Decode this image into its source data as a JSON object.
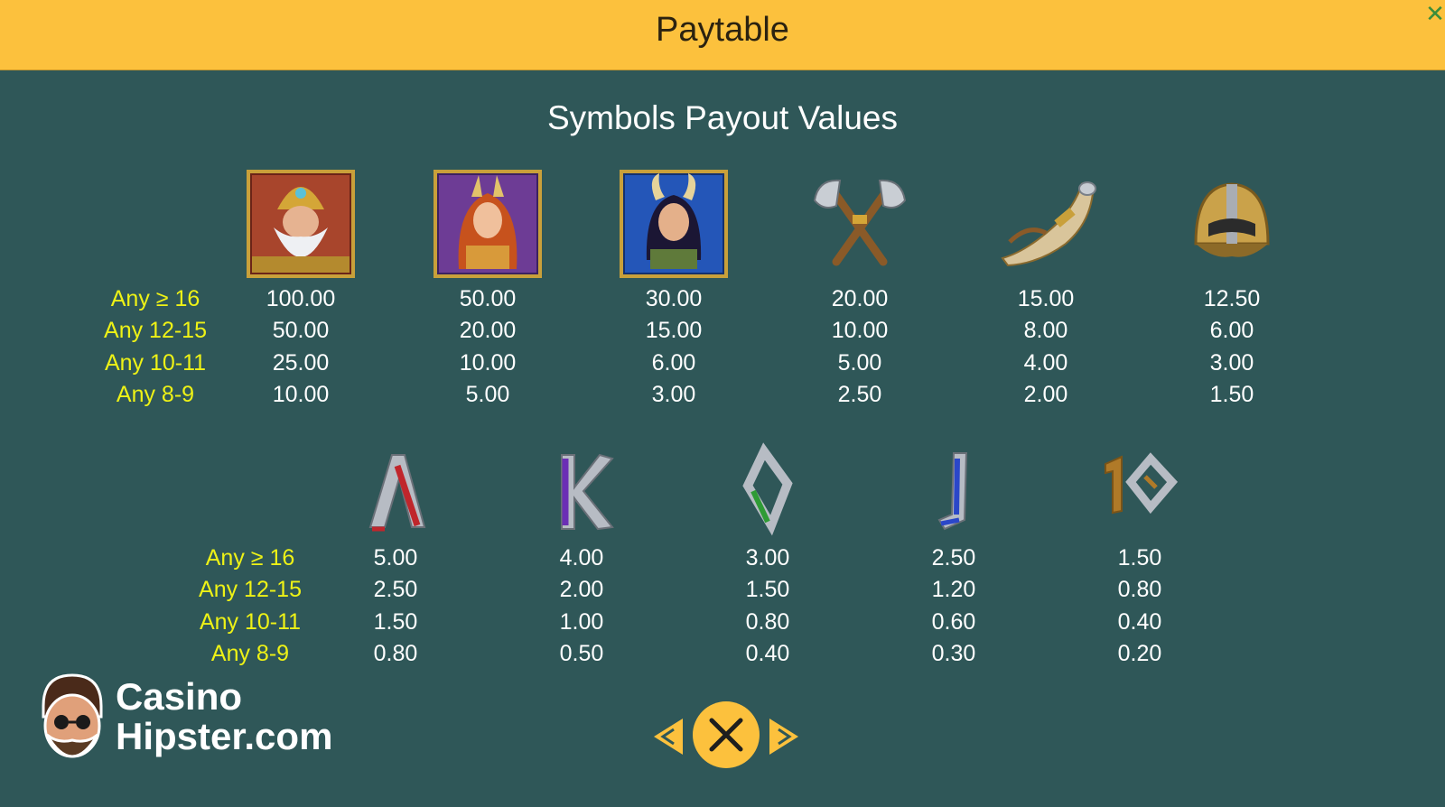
{
  "header": {
    "title": "Paytable",
    "close_glyph": "✕"
  },
  "subtitle": "Symbols Payout Values",
  "row_labels": [
    "Any ≥ 16",
    "Any 12-15",
    "Any 10-11",
    "Any 8-9"
  ],
  "high_symbols": [
    {
      "name": "odin-portrait-icon",
      "payouts": [
        "100.00",
        "50.00",
        "25.00",
        "10.00"
      ]
    },
    {
      "name": "freya-portrait-icon",
      "payouts": [
        "50.00",
        "20.00",
        "10.00",
        "5.00"
      ]
    },
    {
      "name": "loki-portrait-icon",
      "payouts": [
        "30.00",
        "15.00",
        "6.00",
        "3.00"
      ]
    },
    {
      "name": "crossed-axes-icon",
      "payouts": [
        "20.00",
        "10.00",
        "5.00",
        "2.50"
      ]
    },
    {
      "name": "drinking-horn-icon",
      "payouts": [
        "15.00",
        "8.00",
        "4.00",
        "2.00"
      ]
    },
    {
      "name": "viking-helmet-icon",
      "payouts": [
        "12.50",
        "6.00",
        "3.00",
        "1.50"
      ]
    }
  ],
  "low_symbols": [
    {
      "name": "rune-a-icon",
      "glyph": "A",
      "color": "#c0262c",
      "payouts": [
        "5.00",
        "2.50",
        "1.50",
        "0.80"
      ]
    },
    {
      "name": "rune-k-icon",
      "glyph": "K",
      "color": "#6b2fb5",
      "payouts": [
        "4.00",
        "2.00",
        "1.00",
        "0.50"
      ]
    },
    {
      "name": "rune-q-icon",
      "glyph": "Q",
      "color": "#2f9b35",
      "payouts": [
        "3.00",
        "1.50",
        "0.80",
        "0.40"
      ]
    },
    {
      "name": "rune-j-icon",
      "glyph": "J",
      "color": "#2b47c9",
      "payouts": [
        "2.50",
        "1.20",
        "0.60",
        "0.30"
      ]
    },
    {
      "name": "rune-10-icon",
      "glyph": "10",
      "color": "#b07a28",
      "payouts": [
        "1.50",
        "0.80",
        "0.40",
        "0.20"
      ]
    }
  ],
  "logo": {
    "line1": "Casino",
    "line2": "Hipster.com"
  },
  "colors": {
    "background": "#2f5758",
    "header": "#fcc13d",
    "label": "#eef216",
    "value": "#ffffff",
    "nav": "#fcc13d"
  }
}
